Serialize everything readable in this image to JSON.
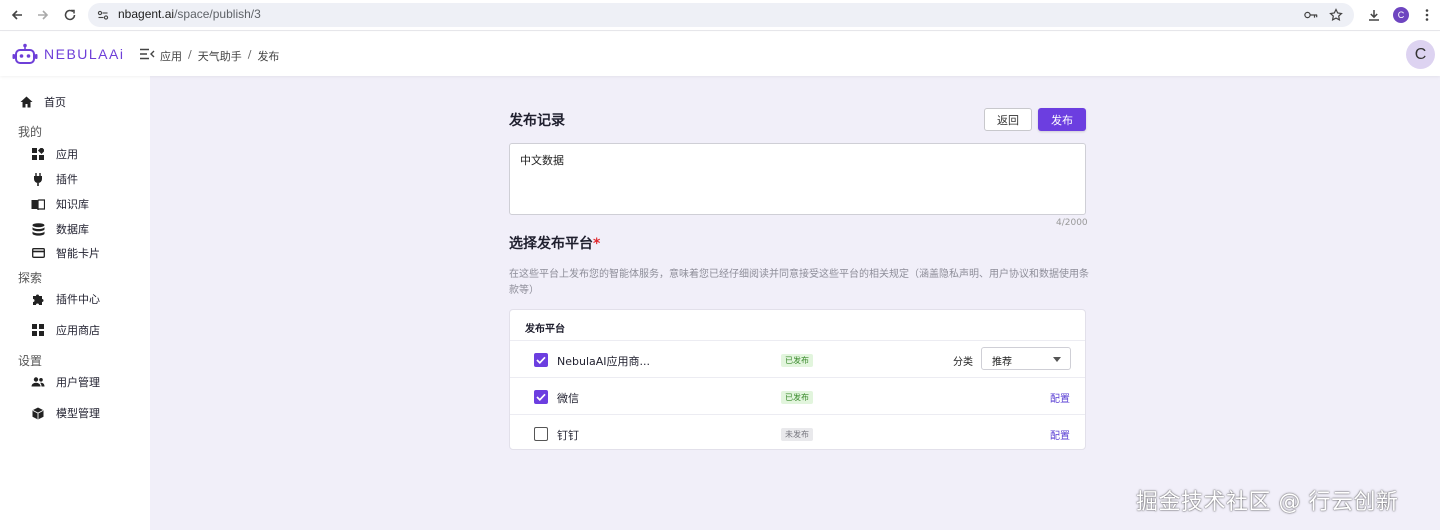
{
  "browser": {
    "url_host": "nbagent.ai",
    "url_path": "/space/publish/3",
    "profile_initial": "C"
  },
  "header": {
    "logo_text": "NEBULAAi",
    "breadcrumb": [
      "应用",
      "天气助手",
      "发布"
    ],
    "breadcrumb_sep": "/",
    "avatar_initial": "C"
  },
  "sidebar": {
    "home": "首页",
    "groups": {
      "mine": "我的",
      "explore": "探索",
      "settings": "设置"
    },
    "mine_items": [
      "应用",
      "插件",
      "知识库",
      "数据库",
      "智能卡片"
    ],
    "explore_items": [
      "插件中心",
      "应用商店"
    ],
    "settings_items": [
      "用户管理",
      "模型管理"
    ]
  },
  "main": {
    "record_title": "发布记录",
    "back_label": "返回",
    "publish_label": "发布",
    "record_text": "中文数据",
    "record_counter": "4/2000",
    "platform_title": "选择发布平台",
    "required_mark": "*",
    "platform_desc": "在这些平台上发布您的智能体服务，意味着您已经仔细阅读并同意接受这些平台的相关规定（涵盖隐私声明、用户协议和数据使用条款等）",
    "card_header": "发布平台",
    "platforms": [
      {
        "name": "NebulaAI应用商...",
        "status": "已发布",
        "checked": true,
        "category_label": "分类",
        "category_value": "推荐"
      },
      {
        "name": "微信",
        "status": "已发布",
        "checked": true,
        "action": "配置"
      },
      {
        "name": "钉钉",
        "status": "未发布",
        "checked": false,
        "action": "配置"
      }
    ]
  },
  "watermark": "掘金技术社区 @ 行云创新",
  "colors": {
    "accent": "#6c3ee0",
    "content_bg": "#f1eff9",
    "published_bg": "#e2f5dd",
    "unpublished_bg": "#e9e9ec"
  }
}
